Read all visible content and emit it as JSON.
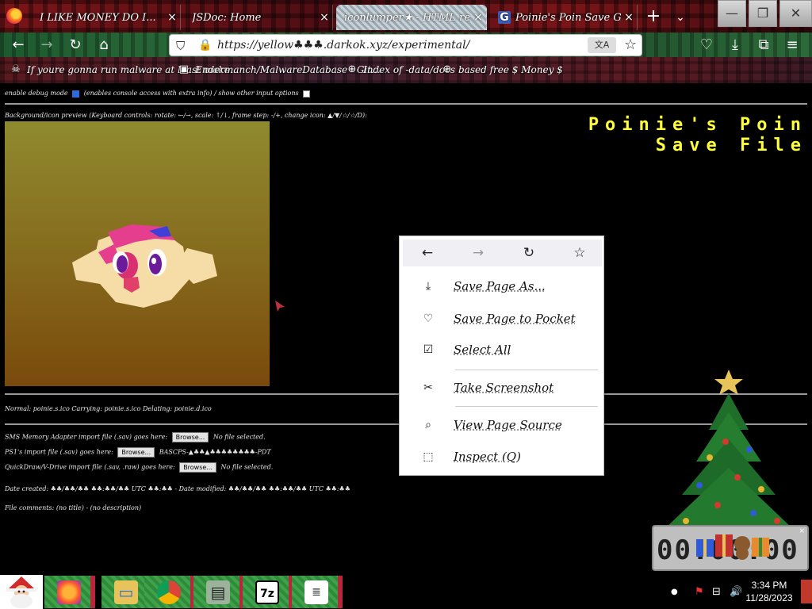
{
  "browser": {
    "tabs": [
      {
        "label": "I LIKE MONEY DO I...",
        "close": "×"
      },
      {
        "label": "JSDoc: Home",
        "close": "×"
      },
      {
        "label": "iconlumper★ - HTML reference",
        "close": "×"
      },
      {
        "label": "Poinie's Poin Save Game E...",
        "close": "×"
      }
    ],
    "tab4_favicon": "G",
    "new_tab": "+",
    "tab_list": "⌄",
    "window_controls": {
      "minimize": "—",
      "restore": "❐",
      "close": "✕"
    },
    "nav": {
      "back": "←",
      "forward": "→",
      "reload": "↻",
      "home": "⌂"
    },
    "url": "https://yellow♣♣♣.darkok.xyz/experimental/",
    "url_icons": {
      "shield": "⛉",
      "lock": "🔒",
      "translate": "文A",
      "star": "☆"
    },
    "toolbar_icons": {
      "pocket": "♡",
      "download": "⤓",
      "extensions": "⧉",
      "menu": "≡"
    },
    "bookmarks": [
      {
        "icon": "☠",
        "label": "If youre gonna run malware at least make..."
      },
      {
        "icon": "▣",
        "label": "Endermanch/MalwareDatabase - Git..."
      },
      {
        "icon": "⊕",
        "label": "Index of -data/docs"
      },
      {
        "icon": "⊕",
        "label": "based free $ Money $"
      }
    ]
  },
  "page": {
    "options_line": {
      "before_chk1": "enable debug mode",
      "after_chk1": "(enables console access with extra info) / show other input options",
      "chk1_checked": true,
      "chk2_checked": false
    },
    "bg_preview_label": "Background/icon preview (Keyboard controls: rotate: ←/→, scale: ↑/↓, frame step: -/+, change icon: ▲/▼/☆/☆/D):",
    "title_line1": "Poinie's Poin",
    "title_line2": "Save File",
    "info_line": "Normal: poinie.s.ico Carrying: poinie.s.ico Delating: poinie.d.ico",
    "input_rows": [
      {
        "before": "SMS Memory Adapter import file (.sav) goes here:",
        "button": "Browse...",
        "after": "No file selected."
      },
      {
        "before": "PS1's import file (.sav) goes here:",
        "button": "Browse...",
        "after": "BASCPS-▲♣♣▲♣♣♣♣♣♣♣♣-PDT"
      },
      {
        "before": "QuickDraw/V-Drive import file (.sav, .raw) goes here:",
        "button": "Browse...",
        "after": "No file selected."
      }
    ],
    "date_line": "Date created: ♣♣/♣♣/♣♣ ♣♣:♣♣/♣♣ UTC ♣♣:♣♣ - Date modified: ♣♣/♣♣/♣♣ ♣♣:♣♣/♣♣ UTC ♣♣:♣♣",
    "file_comments": "File comments: (no title) - (no description)"
  },
  "context_menu": {
    "nav": {
      "back": "←",
      "forward": "→",
      "reload": "↻",
      "bookmark": "☆"
    },
    "items": [
      {
        "icon": "⤓",
        "label": "Save Page As..."
      },
      {
        "icon": "♡",
        "label": "Save Page to Pocket"
      },
      {
        "icon": "☑",
        "label": "Select All"
      },
      {
        "icon": "✂",
        "label": "Take Screenshot"
      },
      {
        "icon": "⌕",
        "label": "View Page Source"
      },
      {
        "icon": "⬚",
        "label": "Inspect (Q)"
      }
    ]
  },
  "widget": {
    "clock_digits": "00:00:00",
    "close": "×"
  },
  "taskbar": {
    "apps": [
      {
        "icon": "🦊",
        "name": "firefox-icon"
      },
      {
        "icon": "🗂",
        "name": "file-explorer-icon"
      },
      {
        "icon": "◉",
        "name": "chrome-icon"
      },
      {
        "icon": "🖥",
        "name": "computer-icon"
      },
      {
        "icon": "7z",
        "name": "7zip-icon"
      },
      {
        "icon": "📄",
        "name": "notepad-icon"
      }
    ],
    "tray": {
      "dot": "●",
      "flag": "⚑",
      "network": "⊟",
      "volume": "🔊"
    },
    "time": "3:34 PM",
    "date": "11/28/2023"
  }
}
